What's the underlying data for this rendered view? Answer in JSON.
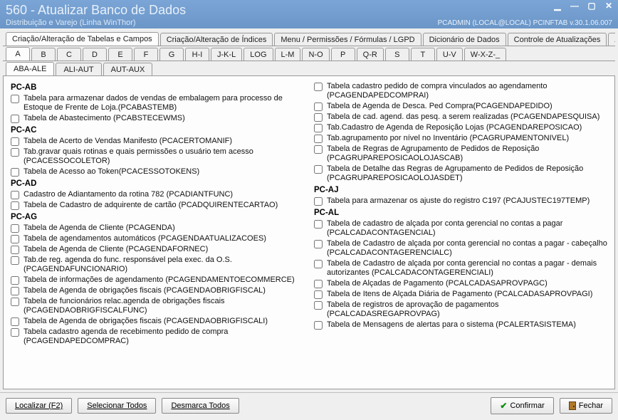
{
  "window": {
    "title": "560 - Atualizar Banco de Dados",
    "subtitle": "Distribuição e Varejo (Linha WinThor)",
    "status": "PCADMIN (LOCAL@LOCAL)   PCINFTAB   v.30.1.06.007"
  },
  "mainTabs": [
    "Criação/Alteração de Tabelas e Campos",
    "Criação/Alteração de Índices",
    "Menu / Permissões / Fórmulas / LGPD",
    "Dicionário de Dados",
    "Controle de Atualizações",
    "Andame"
  ],
  "alphaTabs": [
    "A",
    "B",
    "C",
    "D",
    "E",
    "F",
    "G",
    "H-I",
    "J-K-L",
    "LOG",
    "L-M",
    "N-O",
    "P",
    "Q-R",
    "S",
    "T",
    "U-V",
    "W-X-Z-_"
  ],
  "subTabs": [
    "ABA-ALE",
    "ALI-AUT",
    "AUT-AUX"
  ],
  "colLeft": [
    {
      "type": "header",
      "text": "PC-AB"
    },
    {
      "type": "item",
      "text": "Tabela para armazenar dados de vendas de embalagem para processo de Estoque de Frente de Loja.(PCABASTEMB)"
    },
    {
      "type": "item",
      "text": "Tabela de Abastecimento (PCABSTECEWMS)"
    },
    {
      "type": "header",
      "text": "PC-AC"
    },
    {
      "type": "item",
      "text": "Tabela de Acerto de Vendas Manifesto (PCACERTOMANIF)"
    },
    {
      "type": "item",
      "text": "Tab.gravar quais rotinas e quais permissões o usuário tem acesso (PCACESSOCOLETOR)"
    },
    {
      "type": "item",
      "text": "Tabela de Acesso ao Token(PCACESSOTOKENS)"
    },
    {
      "type": "header",
      "text": "PC-AD"
    },
    {
      "type": "item",
      "text": "Cadastro de Adiantamento da rotina 782 (PCADIANTFUNC)"
    },
    {
      "type": "item",
      "text": "Tabela de Cadastro de adquirente de cartão (PCADQUIRENTECARTAO)"
    },
    {
      "type": "header",
      "text": "PC-AG"
    },
    {
      "type": "item",
      "text": "Tabela  de Agenda de Cliente (PCAGENDA)"
    },
    {
      "type": "item",
      "text": "Tabela de agendamentos automáticos (PCAGENDAATUALIZACOES)"
    },
    {
      "type": "item",
      "text": "Tabela  de Agenda de Cliente (PCAGENDAFORNEC)"
    },
    {
      "type": "item",
      "text": "Tab.de reg. agenda do func. responsável pela exec. da O.S.(PCAGENDAFUNCIONARIO)"
    },
    {
      "type": "item",
      "text": "Tabela de informações de agendamento (PCAGENDAMENTOECOMMERCE)"
    },
    {
      "type": "item",
      "text": "Tabela de Agenda de obrigações fiscais (PCAGENDAOBRIGFISCAL)"
    },
    {
      "type": "item",
      "text": "Tabela de funcionários relac.agenda de obrigações fiscais (PCAGENDAOBRIGFISCALFUNC)"
    },
    {
      "type": "item",
      "text": "Tabela de Agenda de obrigações fiscais (PCAGENDAOBRIGFISCALI)"
    },
    {
      "type": "item",
      "text": "Tabela cadastro agenda de recebimento pedido de compra (PCAGENDAPEDCOMPRAC)"
    }
  ],
  "colRight": [
    {
      "type": "item",
      "text": "Tabela cadastro pedido de compra vinculados ao agendamento (PCAGENDAPEDCOMPRAI)"
    },
    {
      "type": "item",
      "text": "Tabela  de Agenda de Desca. Ped Compra(PCAGENDAPEDIDO)"
    },
    {
      "type": "item",
      "text": "Tabela de cad. agend. das pesq. a serem realizadas (PCAGENDAPESQUISA)"
    },
    {
      "type": "item",
      "text": "Tab.Cadastro de Agenda de Reposição Lojas (PCAGENDAREPOSICAO)"
    },
    {
      "type": "item",
      "text": "Tab.agrupamento por nível no Inventário (PCAGRUPAMENTONIVEL)"
    },
    {
      "type": "item",
      "text": "Tabela de Regras de Agrupamento de Pedidos de Reposição (PCAGRUPAREPOSICAOLOJASCAB)"
    },
    {
      "type": "item",
      "text": "Tabela de Detalhe das Regras de Agrupamento de Pedidos de Reposição (PCAGRUPAREPOSICAOLOJASDET)"
    },
    {
      "type": "header",
      "text": "PC-AJ"
    },
    {
      "type": "item",
      "text": "Tabela para armazenar os ajuste do registro C197 (PCAJUSTEC197TEMP)"
    },
    {
      "type": "header",
      "text": "PC-AL"
    },
    {
      "type": "item",
      "text": "Tabela de cadastro de alçada por conta gerencial no contas a pagar (PCALCADACONTAGENCIAL)"
    },
    {
      "type": "item",
      "text": "Tabela de Cadastro de alçada por conta gerencial no contas a pagar - cabeçalho (PCALCADACONTAGERENCIALC)"
    },
    {
      "type": "item",
      "text": "Tabela de Cadastro de alçada por conta gerencial no contas a pagar - demais autorizantes (PCALCADACONTAGERENCIALI)"
    },
    {
      "type": "item",
      "text": "Tabela de Alçadas de Pagamento (PCALCADASAPROVPAGC)"
    },
    {
      "type": "item",
      "text": "Tabela de Itens de Alçada Diária de Pagamento (PCALCADASAPROVPAGI)"
    },
    {
      "type": "item",
      "text": "Tabela de registros de aprovação de pagamentos (PCALCADASREGAPROVPAG)"
    },
    {
      "type": "item",
      "text": "Tabela de Mensagens de alertas para o sistema (PCALERTASISTEMA)"
    }
  ],
  "footer": {
    "localizar": "Localizar (F2)",
    "selecionarTodos": "Selecionar Todos",
    "desmarcaTodos": "Desmarca Todos",
    "confirmar": "Confirmar",
    "fechar": "Fechar"
  }
}
